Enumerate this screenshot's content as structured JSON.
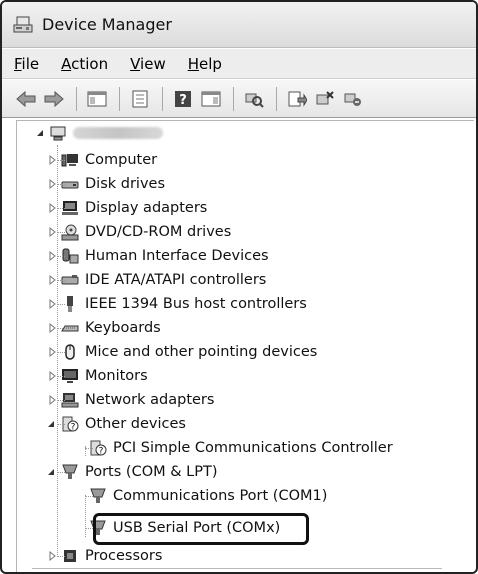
{
  "window": {
    "title": "Device Manager",
    "icon": "device-manager-icon"
  },
  "menu": [
    {
      "label_acc": "F",
      "label_rest": "ile"
    },
    {
      "label_acc": "A",
      "label_rest": "ction"
    },
    {
      "label_acc": "V",
      "label_rest": "iew"
    },
    {
      "label_acc": "H",
      "label_rest": "elp"
    }
  ],
  "toolbar": [
    "back-icon",
    "forward-icon",
    "show-hide-tree-icon",
    "properties-icon",
    "help-icon",
    "action-pane-icon",
    "scan-hardware-icon",
    "update-driver-icon",
    "uninstall-icon",
    "disable-icon"
  ],
  "tree": {
    "root_label": "",
    "categories": [
      {
        "label": "Computer",
        "icon": "computer-icon"
      },
      {
        "label": "Disk drives",
        "icon": "disk-drive-icon"
      },
      {
        "label": "Display adapters",
        "icon": "display-adapter-icon"
      },
      {
        "label": "DVD/CD-ROM drives",
        "icon": "dvd-drive-icon"
      },
      {
        "label": "Human Interface Devices",
        "icon": "hid-icon"
      },
      {
        "label": "IDE ATA/ATAPI controllers",
        "icon": "ide-controller-icon"
      },
      {
        "label": "IEEE 1394 Bus host controllers",
        "icon": "ieee1394-icon"
      },
      {
        "label": "Keyboards",
        "icon": "keyboard-icon"
      },
      {
        "label": "Mice and other pointing devices",
        "icon": "mouse-icon"
      },
      {
        "label": "Monitors",
        "icon": "monitor-icon"
      },
      {
        "label": "Network adapters",
        "icon": "network-adapter-icon"
      },
      {
        "label": "Other devices",
        "icon": "unknown-device-icon"
      },
      {
        "label": "PCI Simple Communications Controller",
        "icon": "unknown-device-icon"
      },
      {
        "label": "Ports (COM & LPT)",
        "icon": "port-icon"
      },
      {
        "label": "Communications Port (COM1)",
        "icon": "port-icon"
      },
      {
        "label": "USB Serial Port (COMx)",
        "icon": "port-icon"
      },
      {
        "label": "Processors",
        "icon": "processor-icon"
      }
    ]
  }
}
